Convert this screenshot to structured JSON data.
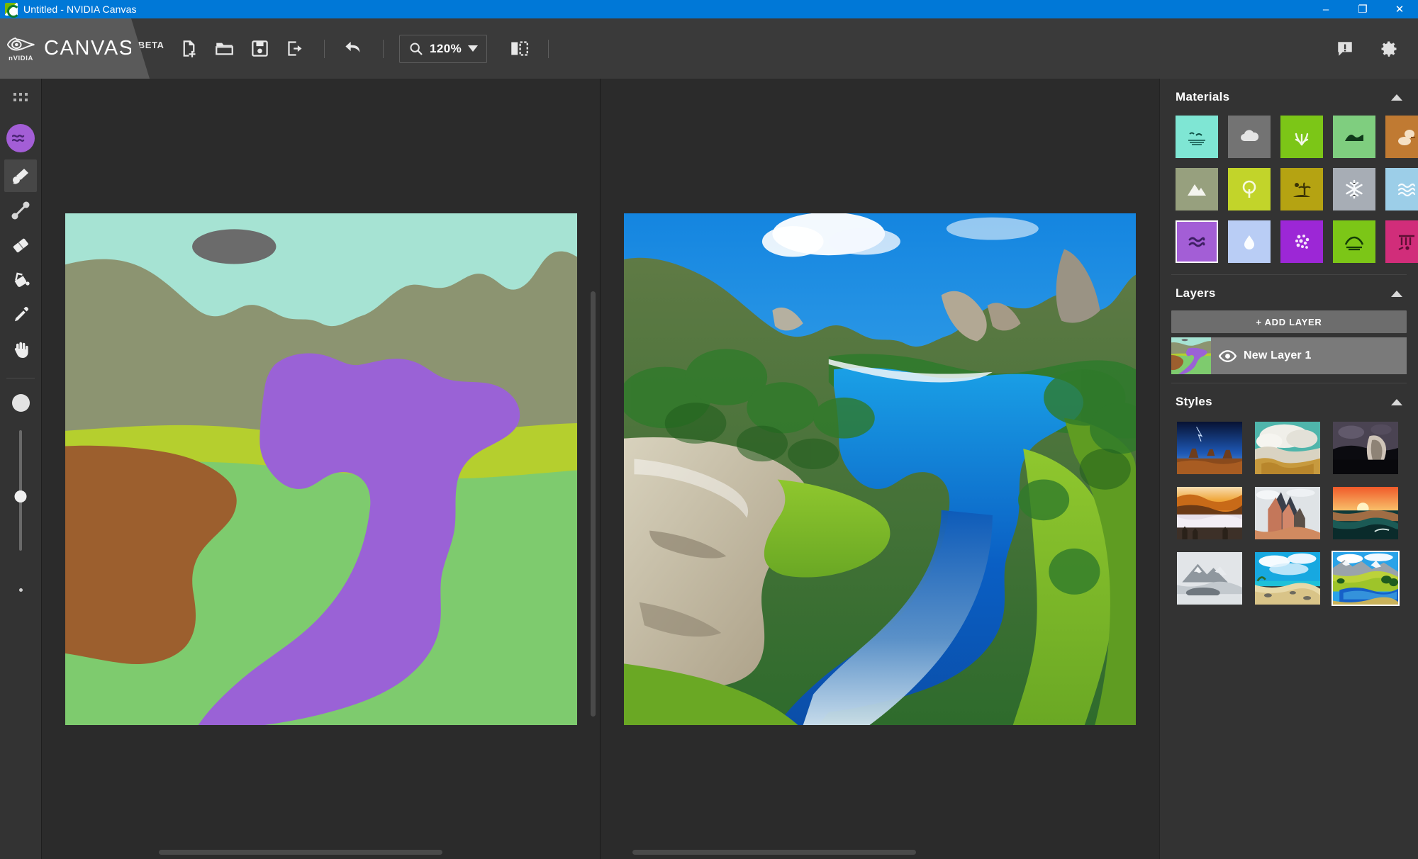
{
  "window": {
    "title": "Untitled - NVIDIA Canvas",
    "app_icon": "nvidia-canvas-icon",
    "minimize_label": "–",
    "restore_label": "❐",
    "close_label": "✕",
    "titlebar_color": "#0078d7"
  },
  "brand": {
    "name": "CANVAS",
    "badge": "BETA",
    "vendor": "nVIDIA"
  },
  "toolbar": {
    "new_label": "new-document",
    "open_label": "open-folder",
    "save_label": "save",
    "export_label": "export",
    "undo_label": "undo",
    "zoom_value": "120%",
    "zoom_icon": "magnifier-icon",
    "panel_toggle_label": "toggle-split-view",
    "feedback_label": "feedback",
    "settings_label": "settings"
  },
  "tools": {
    "items": [
      {
        "name": "grid-toggle",
        "icon": "grid-dots-icon",
        "active": false
      },
      {
        "name": "paint-brush",
        "icon": "brush-icon",
        "active": true
      },
      {
        "name": "line-tool",
        "icon": "line-icon",
        "active": false
      },
      {
        "name": "eraser",
        "icon": "eraser-icon",
        "active": false
      },
      {
        "name": "paint-bucket",
        "icon": "bucket-icon",
        "active": false
      },
      {
        "name": "eyedropper",
        "icon": "eyedropper-icon",
        "active": false
      },
      {
        "name": "pan-hand",
        "icon": "hand-icon",
        "active": false
      }
    ],
    "current_material_color": "#a35ed6",
    "current_material_icon": "water-waves-icon",
    "brush_size_percent": 50
  },
  "materials": {
    "title": "Materials",
    "collapse_icon": "chevron-up-icon",
    "items": [
      {
        "label": "Sky",
        "color": "#7fe6d4",
        "icon": "sky-birds-icon",
        "selected": false
      },
      {
        "label": "Cloud",
        "color": "#737373",
        "icon": "cloud-icon",
        "selected": false
      },
      {
        "label": "Grass",
        "color": "#7cc617",
        "icon": "grass-icon",
        "selected": false
      },
      {
        "label": "Hill",
        "color": "#7fce7f",
        "icon": "hill-icon",
        "selected": false
      },
      {
        "label": "Sand",
        "color": "#c07a32",
        "icon": "sand-rock-icon",
        "selected": false
      },
      {
        "label": "Mountain",
        "color": "#97a07e",
        "icon": "mountain-icon",
        "selected": false
      },
      {
        "label": "Tree",
        "color": "#c2d42a",
        "icon": "tree-icon",
        "selected": false
      },
      {
        "label": "Island",
        "color": "#b5a312",
        "icon": "island-palm-icon",
        "selected": false
      },
      {
        "label": "Snow",
        "color": "#a7adb5",
        "icon": "snowflake-icon",
        "selected": false
      },
      {
        "label": "Sea",
        "color": "#9ccee8",
        "icon": "sea-waves-icon",
        "selected": false
      },
      {
        "label": "Water",
        "color": "#a35ed6",
        "icon": "water-waves-icon",
        "selected": true
      },
      {
        "label": "Fog",
        "color": "#b9cdf5",
        "icon": "water-drop-icon",
        "selected": false
      },
      {
        "label": "Flowers",
        "color": "#9c27d6",
        "icon": "flowers-icon",
        "selected": false
      },
      {
        "label": "Bush",
        "color": "#7cc617",
        "icon": "bush-icon",
        "selected": false
      },
      {
        "label": "Ruins",
        "color": "#d12d7a",
        "icon": "ruins-icon",
        "selected": false
      }
    ]
  },
  "layers": {
    "title": "Layers",
    "collapse_icon": "chevron-up-icon",
    "add_label": "+ ADD LAYER",
    "items": [
      {
        "name": "New Layer 1",
        "visible": true,
        "eye_icon": "eye-icon"
      }
    ]
  },
  "styles": {
    "title": "Styles",
    "collapse_icon": "chevron-up-icon",
    "items": [
      {
        "label": "Storm Mesa",
        "selected": false
      },
      {
        "label": "Cumulus Rocks",
        "selected": false
      },
      {
        "label": "Night Cave",
        "selected": false
      },
      {
        "label": "Golden Fog",
        "selected": false
      },
      {
        "label": "Red Cliffs",
        "selected": false
      },
      {
        "label": "Ocean Sunset",
        "selected": false
      },
      {
        "label": "Misty Mountains",
        "selected": false
      },
      {
        "label": "Blue Beach",
        "selected": false
      },
      {
        "label": "Alpine Lake",
        "selected": true
      }
    ]
  },
  "canvas": {
    "left_pane_name": "segmentation-sketch",
    "right_pane_name": "ai-rendered-output",
    "sketch_colors": {
      "sky": "#a6e3d3",
      "cloud": "#6b6b6b",
      "mountain": "#8c9471",
      "grass_band": "#b5cf2e",
      "grass": "#7ecb6e",
      "sand": "#9c5f2e",
      "water": "#9a62d6"
    },
    "render_colors": {
      "sky": "#1e9fe8",
      "lake": "#0a63c9",
      "grass": "#7fc427",
      "rock": "#c9bfa6",
      "forest": "#2f7a2a"
    }
  }
}
